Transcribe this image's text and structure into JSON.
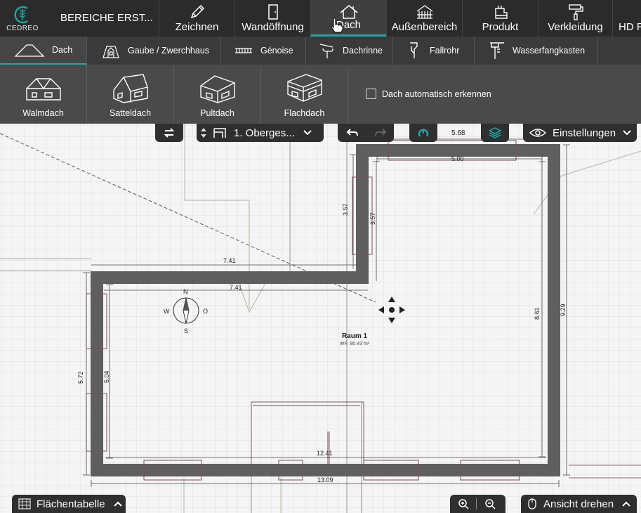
{
  "app": {
    "brand": "CEDREO",
    "project_title": "BEREICHE ERST..."
  },
  "main_tabs": [
    {
      "label": "Zeichnen",
      "icon": "pencil-icon"
    },
    {
      "label": "Wandöffnung",
      "icon": "door-icon"
    },
    {
      "label": "Dach",
      "icon": "roof-icon",
      "active": true
    },
    {
      "label": "Außenbereich",
      "icon": "terrace-icon"
    },
    {
      "label": "Produkt",
      "icon": "furniture-icon"
    },
    {
      "label": "Verkleidung",
      "icon": "paint-roller-icon"
    },
    {
      "label": "HD R",
      "icon": ""
    }
  ],
  "sub_tabs": [
    {
      "label": "Dach",
      "icon": "roof-outline-icon",
      "active": true
    },
    {
      "label": "Gaube / Zwerchhaus",
      "icon": "dormer-icon"
    },
    {
      "label": "Génoise",
      "icon": "genoise-icon"
    },
    {
      "label": "Dachrinne",
      "icon": "gutter-icon"
    },
    {
      "label": "Fallrohr",
      "icon": "downpipe-icon"
    },
    {
      "label": "Wasserfangkasten",
      "icon": "rainwater-head-icon"
    }
  ],
  "roof_types": [
    {
      "label": "Walmdach",
      "icon": "hip-roof-icon"
    },
    {
      "label": "Satteldach",
      "icon": "gable-roof-icon"
    },
    {
      "label": "Pultdach",
      "icon": "shed-roof-icon"
    },
    {
      "label": "Flachdach",
      "icon": "flat-roof-icon"
    }
  ],
  "auto_detect": {
    "label": "Dach automatisch erkennen",
    "checked": false
  },
  "toolbar": {
    "floor_label": "1. Oberges...",
    "settings_label": "Einstellungen",
    "area_table_label": "Flächentabelle",
    "rotate_view_label": "Ansicht drehen"
  },
  "plan": {
    "room_name": "Raum 1",
    "room_area": "WF: 80.43 m²",
    "compass": {
      "n": "N",
      "s": "S",
      "w": "W",
      "o": "O"
    },
    "dimensions": {
      "d568": "5.68",
      "d500": "5.00",
      "d357a": "3.57",
      "d357b": "3.57",
      "d741a": "7.41",
      "d741b": "7.41",
      "d861": "8.61",
      "d929": "9.29",
      "d572": "5.72",
      "d504": "5.04",
      "d1241": "12.41",
      "d1309": "13.09"
    }
  },
  "colors": {
    "accent": "#1fa7a7",
    "wall": "#5f5f5f",
    "topbar": "#2b2b2b"
  }
}
